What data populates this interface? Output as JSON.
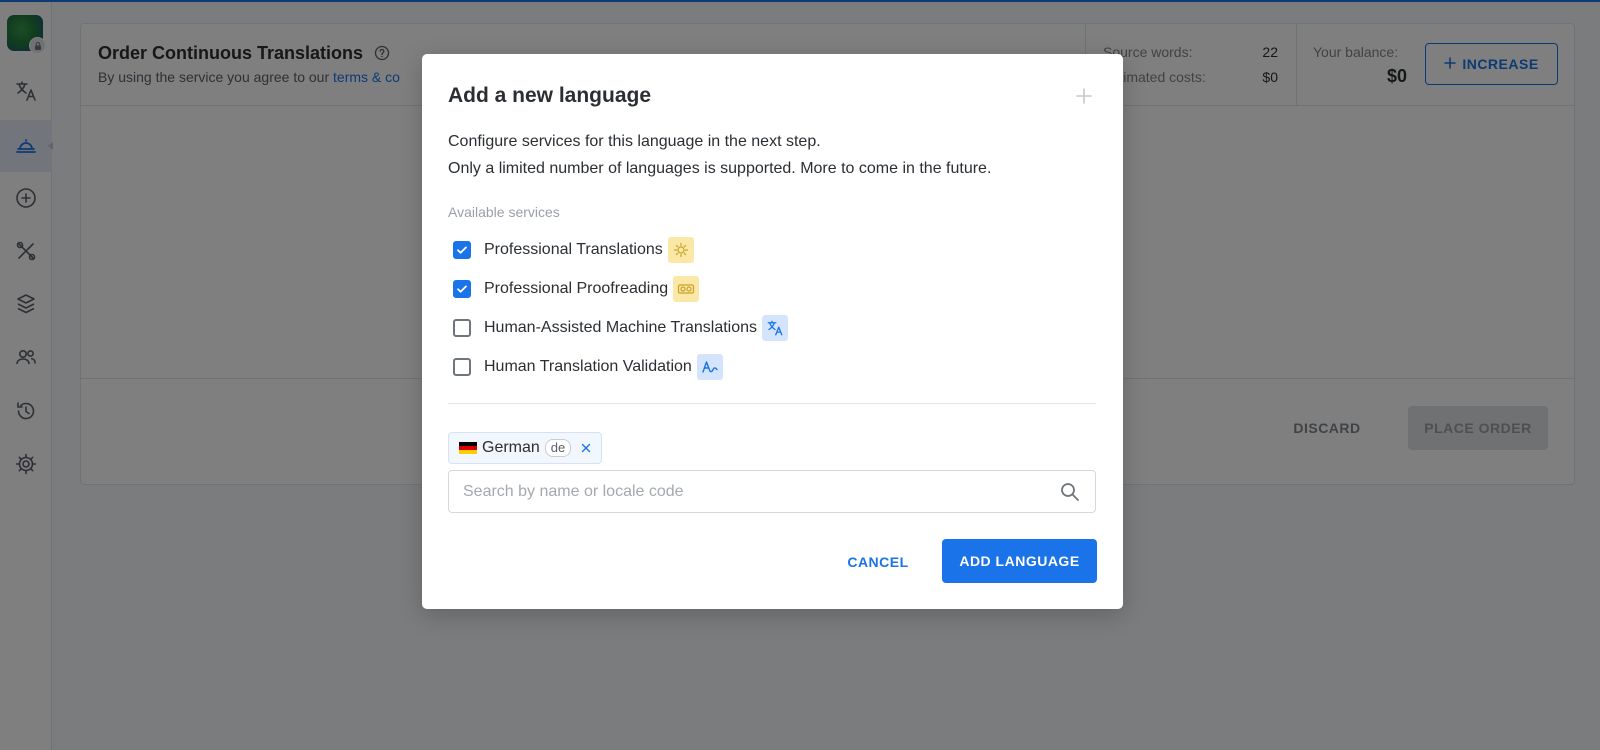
{
  "page": {
    "title": "Order Continuous Translations",
    "agreement_prefix": "By using the service you agree to our ",
    "agreement_link": "terms & co"
  },
  "stats": {
    "source_words_label": "Source words:",
    "source_words_value": "22",
    "estimated_costs_label": "Estimated costs:",
    "estimated_costs_value": "$0"
  },
  "balance": {
    "label": "Your balance:",
    "value": "$0",
    "increase_label": "INCREASE"
  },
  "footer": {
    "discard_label": "DISCARD",
    "place_order_label": "PLACE ORDER"
  },
  "sidebar": {
    "items": [
      {
        "icon": "translate-icon",
        "active": false
      },
      {
        "icon": "service-bell-icon",
        "active": true
      },
      {
        "icon": "plus-circle-icon",
        "active": false
      },
      {
        "icon": "tools-icon",
        "active": false
      },
      {
        "icon": "integrations-icon",
        "active": false
      },
      {
        "icon": "users-icon",
        "active": false
      },
      {
        "icon": "history-icon",
        "active": false
      },
      {
        "icon": "settings-icon",
        "active": false
      }
    ]
  },
  "modal": {
    "title": "Add a new language",
    "description_line1": "Configure services for this language in the next step.",
    "description_line2": "Only a limited number of languages is supported. More to come in the future.",
    "services_label": "Available services",
    "services": [
      {
        "label": "Professional Translations",
        "checked": true,
        "icon": "sun-badge-icon"
      },
      {
        "label": "Professional Proofreading",
        "checked": true,
        "icon": "glasses-badge-icon"
      },
      {
        "label": "Human-Assisted Machine Translations",
        "checked": false,
        "icon": "translate-badge-icon"
      },
      {
        "label": "Human Translation Validation",
        "checked": false,
        "icon": "signature-badge-icon"
      }
    ],
    "selected_language": {
      "name": "German",
      "code": "de",
      "flag_colors": [
        "#000000",
        "#dd0000",
        "#ffce00"
      ]
    },
    "search_placeholder": "Search by name or locale code",
    "search_value": "",
    "cancel_label": "CANCEL",
    "add_label": "ADD LANGUAGE"
  },
  "colors": {
    "accent": "#1a73e8",
    "badge_yellow": "#fbe7a6",
    "badge_blue": "#d4e5fb",
    "overlay": "rgba(0,0,0,0.5)"
  }
}
